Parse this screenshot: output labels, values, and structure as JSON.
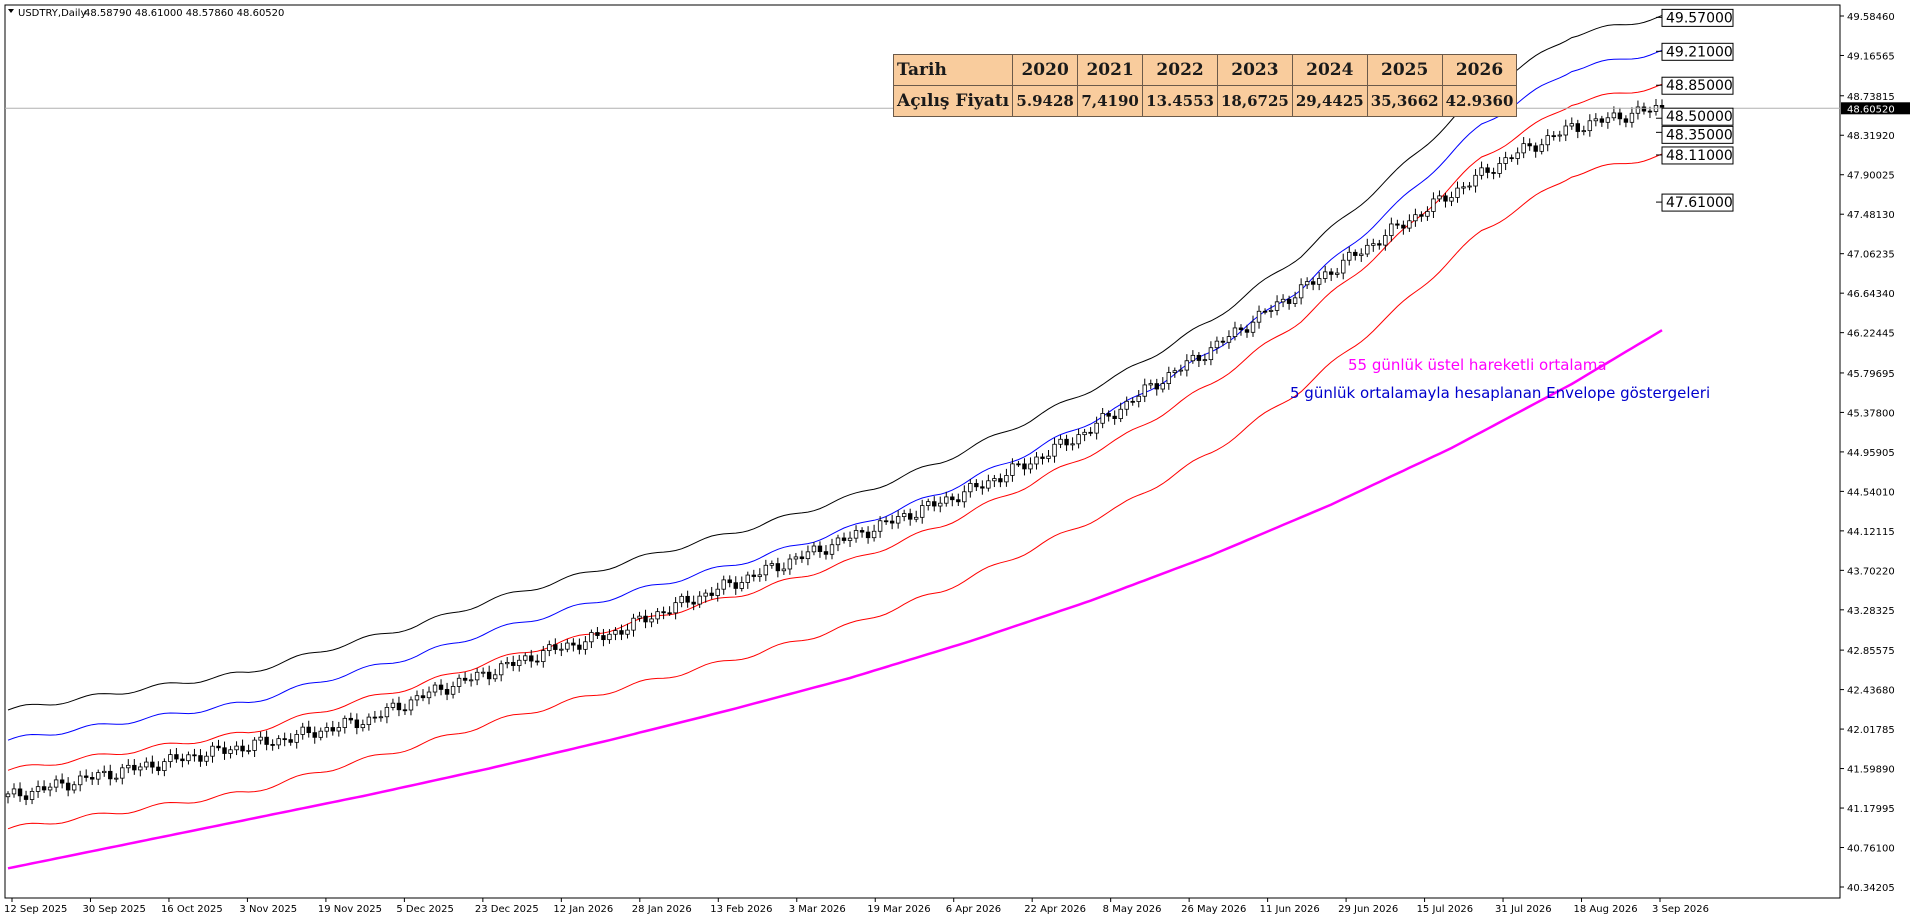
{
  "header": {
    "symbol_text": "USDTRY,Daily",
    "ohlc_text": "48.58790 48.61000 48.57860 48.60520"
  },
  "table": {
    "row1_label": "Tarih",
    "row2_label": "Açılış Fiyatı",
    "years": [
      "2020",
      "2021",
      "2022",
      "2023",
      "2024",
      "2025",
      "2026"
    ],
    "open_prices": [
      "5.9428",
      "7,4190",
      "13.4553",
      "18,6725",
      "29,4425",
      "35,3662",
      "42.9360"
    ]
  },
  "annotations": {
    "ema_label": "55 günlük üstel hareketli ortalama",
    "envelope_label": "5 günlük ortalamayla hesaplanan Envelope göstergeleri"
  },
  "colors": {
    "ema": "#ff00ff",
    "envelope_outer": "#000000",
    "envelope_mid": "#0000ff",
    "envelope_inner": "#ff0000",
    "ema_label_color": "#ff00ff",
    "envelope_label_color": "#0000cc",
    "table_bg": "#f9cc9d"
  },
  "chart_data": {
    "type": "candlestick",
    "y_axis_ticks": [
      "49.58460",
      "49.16565",
      "48.73815",
      "48.31920",
      "47.90025",
      "47.48130",
      "47.06235",
      "46.64340",
      "46.22445",
      "45.79695",
      "45.37800",
      "44.95905",
      "44.54010",
      "44.12115",
      "43.70220",
      "43.28325",
      "42.85575",
      "42.43680",
      "42.01785",
      "41.59890",
      "41.17995",
      "40.76100",
      "40.34205"
    ],
    "x_axis_ticks": [
      "12 Sep 2025",
      "30 Sep 2025",
      "16 Oct 2025",
      "3 Nov 2025",
      "19 Nov 2025",
      "5 Dec 2025",
      "23 Dec 2025",
      "12 Jan 2026",
      "28 Jan 2026",
      "13 Feb 2026",
      "3 Mar 2026",
      "19 Mar 2026",
      "6 Apr 2026",
      "22 Apr 2026",
      "8 May 2026",
      "26 May 2026",
      "11 Jun 2026",
      "29 Jun 2026",
      "15 Jul 2026",
      "31 Jul 2026",
      "18 Aug 2026",
      "3 Sep 2026"
    ],
    "ylim": [
      40.25,
      49.75
    ],
    "current_price": "48.60520",
    "level_labels": [
      "49.57000",
      "49.21000",
      "48.85000",
      "48.50000",
      "48.35000",
      "48.11000",
      "47.61000"
    ],
    "series": [
      {
        "key": "envelope_upper_outer",
        "points": [
          [
            0,
            42.22
          ],
          [
            20,
            42.42
          ],
          [
            40,
            42.62
          ],
          [
            55,
            42.9
          ],
          [
            68,
            43.12
          ],
          [
            80,
            43.38
          ],
          [
            95,
            43.65
          ],
          [
            110,
            43.92
          ],
          [
            125,
            44.18
          ],
          [
            140,
            44.48
          ],
          [
            155,
            44.85
          ],
          [
            170,
            45.3
          ],
          [
            185,
            45.78
          ],
          [
            200,
            46.35
          ],
          [
            215,
            47.05
          ],
          [
            230,
            47.88
          ],
          [
            245,
            48.78
          ],
          [
            260,
            49.38
          ],
          [
            275,
            49.58
          ]
        ]
      },
      {
        "key": "envelope_upper_mid",
        "points": [
          [
            0,
            41.9
          ],
          [
            20,
            42.1
          ],
          [
            40,
            42.3
          ],
          [
            55,
            42.58
          ],
          [
            68,
            42.8
          ],
          [
            80,
            43.05
          ],
          [
            95,
            43.32
          ],
          [
            110,
            43.58
          ],
          [
            125,
            43.84
          ],
          [
            140,
            44.15
          ],
          [
            155,
            44.52
          ],
          [
            170,
            44.96
          ],
          [
            185,
            45.44
          ],
          [
            200,
            46.02
          ],
          [
            215,
            46.7
          ],
          [
            230,
            47.53
          ],
          [
            245,
            48.43
          ],
          [
            260,
            49.02
          ],
          [
            275,
            49.21
          ]
        ]
      },
      {
        "key": "envelope_upper_inner",
        "points": [
          [
            0,
            41.58
          ],
          [
            20,
            41.78
          ],
          [
            40,
            41.98
          ],
          [
            55,
            42.26
          ],
          [
            68,
            42.48
          ],
          [
            80,
            42.73
          ],
          [
            95,
            42.99
          ],
          [
            110,
            43.25
          ],
          [
            125,
            43.5
          ],
          [
            140,
            43.8
          ],
          [
            155,
            44.17
          ],
          [
            170,
            44.62
          ],
          [
            185,
            45.1
          ],
          [
            200,
            45.68
          ],
          [
            215,
            46.36
          ],
          [
            230,
            47.18
          ],
          [
            245,
            48.08
          ],
          [
            260,
            48.66
          ],
          [
            275,
            48.85
          ]
        ]
      },
      {
        "key": "envelope_lower_inner",
        "points": [
          [
            0,
            40.96
          ],
          [
            20,
            41.15
          ],
          [
            40,
            41.35
          ],
          [
            55,
            41.62
          ],
          [
            68,
            41.84
          ],
          [
            80,
            42.08
          ],
          [
            95,
            42.34
          ],
          [
            110,
            42.58
          ],
          [
            125,
            42.83
          ],
          [
            140,
            43.12
          ],
          [
            155,
            43.48
          ],
          [
            170,
            43.92
          ],
          [
            185,
            44.38
          ],
          [
            200,
            44.95
          ],
          [
            215,
            45.62
          ],
          [
            230,
            46.42
          ],
          [
            245,
            47.3
          ],
          [
            260,
            47.9
          ],
          [
            275,
            48.11
          ]
        ]
      },
      {
        "key": "ema_55",
        "points": [
          [
            0,
            40.54
          ],
          [
            20,
            40.8
          ],
          [
            40,
            41.06
          ],
          [
            60,
            41.32
          ],
          [
            80,
            41.6
          ],
          [
            100,
            41.9
          ],
          [
            120,
            42.22
          ],
          [
            140,
            42.56
          ],
          [
            160,
            42.95
          ],
          [
            180,
            43.38
          ],
          [
            200,
            43.86
          ],
          [
            220,
            44.4
          ],
          [
            240,
            45.0
          ],
          [
            260,
            45.68
          ],
          [
            275,
            46.25
          ]
        ]
      }
    ],
    "candles_approx": [
      [
        0,
        41.3
      ],
      [
        15,
        41.52
      ],
      [
        30,
        41.72
      ],
      [
        45,
        41.9
      ],
      [
        60,
        42.12
      ],
      [
        70,
        42.4
      ],
      [
        80,
        42.62
      ],
      [
        90,
        42.85
      ],
      [
        100,
        43.02
      ],
      [
        110,
        43.3
      ],
      [
        120,
        43.55
      ],
      [
        130,
        43.8
      ],
      [
        140,
        44.05
      ],
      [
        150,
        44.3
      ],
      [
        160,
        44.55
      ],
      [
        170,
        44.85
      ],
      [
        180,
        45.2
      ],
      [
        190,
        45.65
      ],
      [
        200,
        46.05
      ],
      [
        210,
        46.48
      ],
      [
        220,
        46.88
      ],
      [
        230,
        47.3
      ],
      [
        240,
        47.7
      ],
      [
        250,
        48.1
      ],
      [
        260,
        48.4
      ],
      [
        270,
        48.55
      ],
      [
        275,
        48.61
      ]
    ]
  }
}
